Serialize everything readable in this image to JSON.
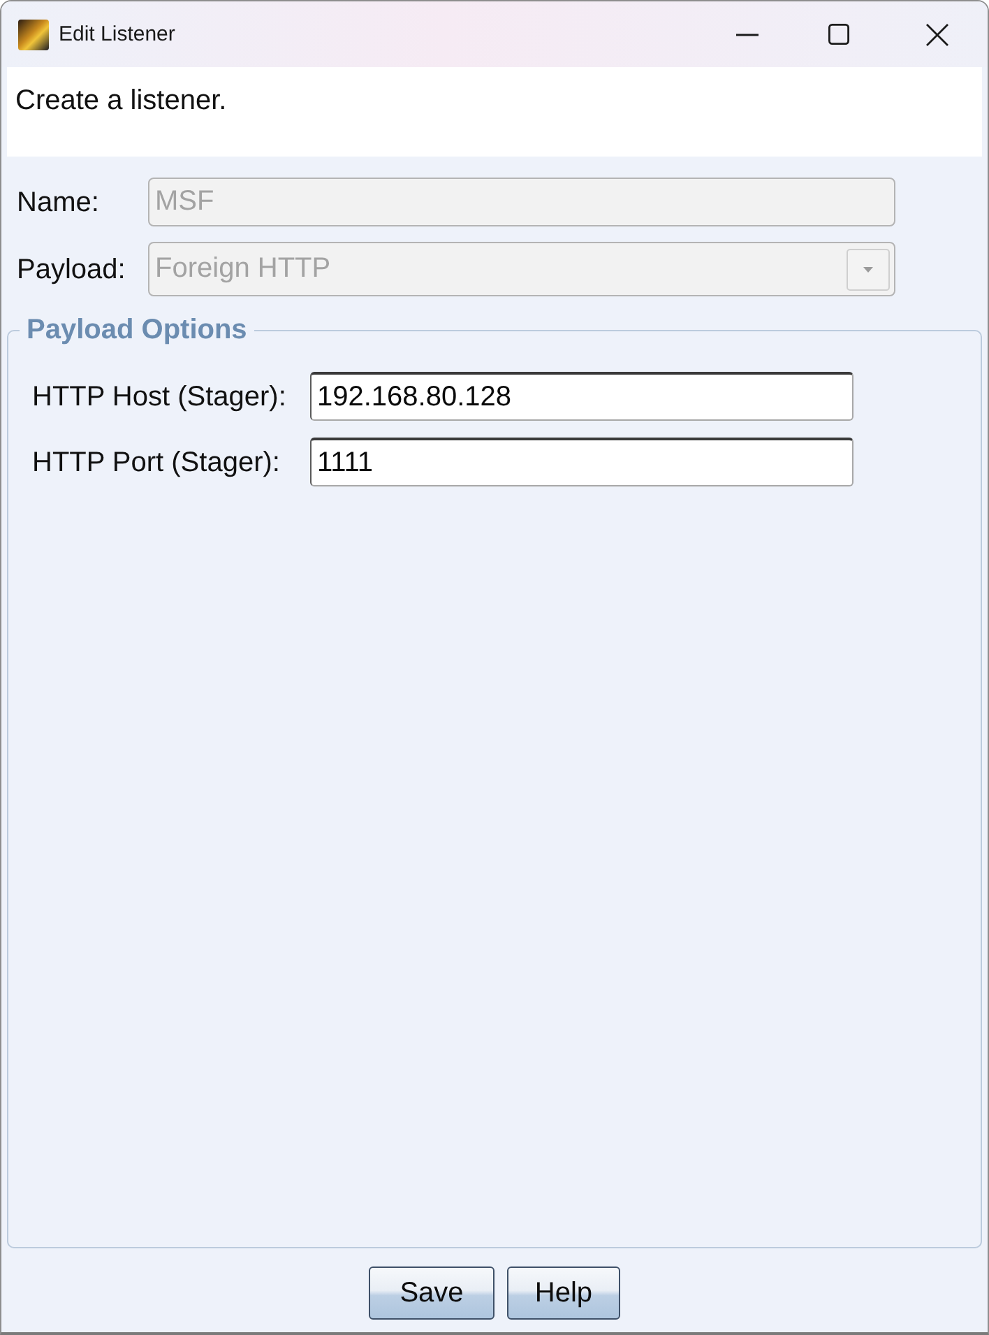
{
  "window": {
    "title": "Edit Listener"
  },
  "description": "Create a listener.",
  "fields": [
    {
      "label": "Name:",
      "value": "MSF",
      "kind": "text",
      "disabled": true
    },
    {
      "label": "Payload:",
      "value": "Foreign HTTP",
      "kind": "dropdown",
      "disabled": true
    }
  ],
  "payload_options": {
    "title": "Payload Options",
    "fields": [
      {
        "label": "HTTP Host (Stager):",
        "value": "192.168.80.128",
        "disabled": false
      },
      {
        "label": "HTTP Port (Stager):",
        "value": "1111",
        "disabled": false
      }
    ]
  },
  "buttons": [
    "Save",
    "Help"
  ]
}
